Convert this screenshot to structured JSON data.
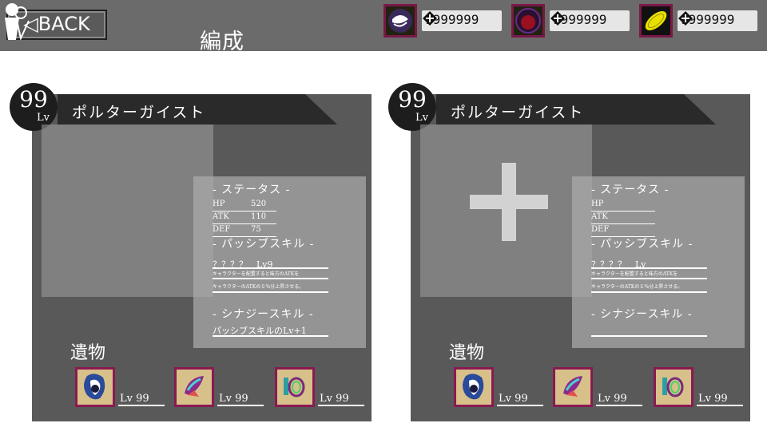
{
  "header": {
    "back_label": "◁BACK",
    "title": "編成",
    "currencies": [
      {
        "icon": "swirl-crystal-icon",
        "value": "9999999"
      },
      {
        "icon": "red-orb-icon",
        "value": "9999999"
      },
      {
        "icon": "gold-coin-icon",
        "value": "9999999"
      }
    ]
  },
  "panels": [
    {
      "level": "99",
      "level_label": "Lv",
      "name": "ポルターガイスト",
      "status_heading": "- ステータス -",
      "stats": [
        {
          "key": "HP",
          "value": "520"
        },
        {
          "key": "ATK",
          "value": "110"
        },
        {
          "key": "DEF",
          "value": "75"
        }
      ],
      "passive_heading": "- パッシブスキル -",
      "passive_name": "？？？？　Lv9",
      "passive_desc": [
        "キャラクターを配置すると味方のATKを",
        "キャラクターのATKの５％分上昇させる。"
      ],
      "synergy_heading": "- シナジースキル -",
      "synergy_text": "パッシブスキルのLv+1",
      "relic_label": "遺物",
      "relics": [
        {
          "icon": "blue-cloak-relic-icon",
          "level": "Lv 99"
        },
        {
          "icon": "feather-wing-relic-icon",
          "level": "Lv 99"
        },
        {
          "icon": "green-ring-relic-icon",
          "level": "Lv 99"
        }
      ]
    },
    {
      "level": "99",
      "level_label": "Lv",
      "name": "ポルターガイスト",
      "status_heading": "- ステータス -",
      "stats": [
        {
          "key": "HP",
          "value": ""
        },
        {
          "key": "ATK",
          "value": ""
        },
        {
          "key": "DEF",
          "value": ""
        }
      ],
      "passive_heading": "- パッシブスキル -",
      "passive_name": "？？？？　Lv",
      "passive_desc": [
        "キャラクターを配置すると味方のATKを",
        "キャラクターのATKの５％分上昇させる。"
      ],
      "synergy_heading": "- シナジースキル -",
      "synergy_text": "",
      "relic_label": "遺物",
      "relics": [
        {
          "icon": "blue-cloak-relic-icon",
          "level": "Lv 99"
        },
        {
          "icon": "feather-wing-relic-icon",
          "level": "Lv 99"
        },
        {
          "icon": "green-ring-relic-icon",
          "level": "Lv 99"
        }
      ]
    }
  ]
}
